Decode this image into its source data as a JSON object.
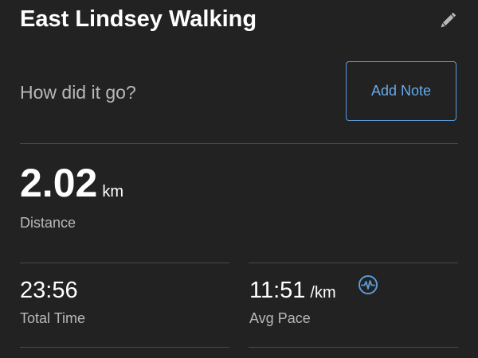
{
  "header": {
    "title": "East Lindsey Walking",
    "edit_icon": "pencil-icon"
  },
  "note": {
    "prompt": "How did it go?",
    "button_label": "Add Note"
  },
  "stats": {
    "distance": {
      "value": "2.02",
      "unit": "km",
      "label": "Distance"
    },
    "total_time": {
      "value": "23:56",
      "label": "Total Time"
    },
    "avg_pace": {
      "value": "11:51",
      "unit": "/km",
      "label": "Avg Pace",
      "icon": "activity-pulse-icon"
    }
  },
  "colors": {
    "background": "#222222",
    "accent": "#5b9bd8",
    "label": "#b8b8b8",
    "divider": "#4a4a4a"
  }
}
